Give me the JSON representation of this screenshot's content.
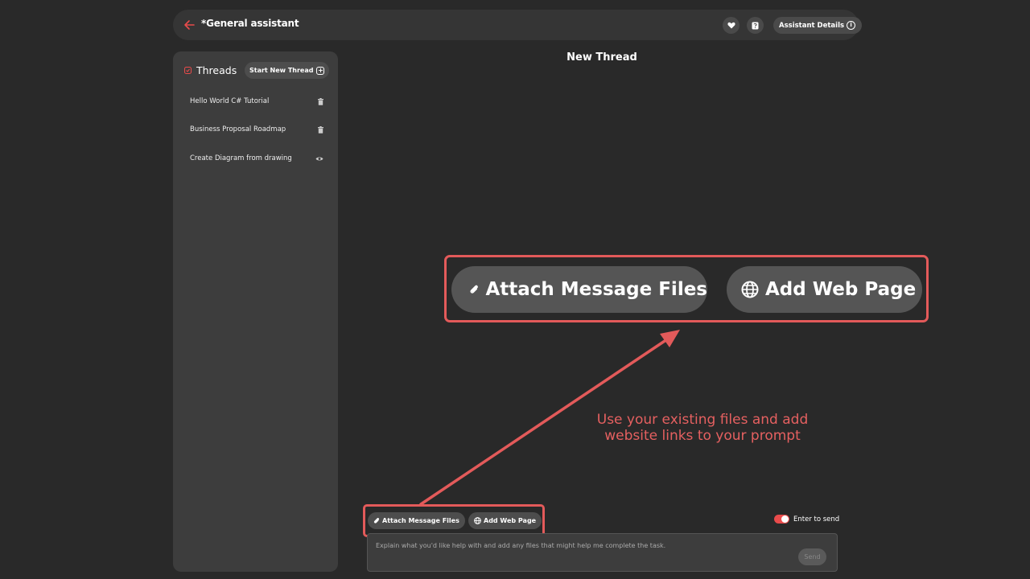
{
  "header": {
    "title": "*General assistant",
    "details_label": "Assistant Details",
    "info_symbol": "i",
    "icons": [
      "back-arrow-icon",
      "heart-icon",
      "question-icon",
      "info-icon"
    ]
  },
  "sidebar": {
    "title": "Threads",
    "new_thread_label": "Start New Thread",
    "plus_symbol": "+",
    "threads": [
      {
        "label": "Hello World C# Tutorial",
        "icon": "trash-icon"
      },
      {
        "label": "Business Proposal Roadmap",
        "icon": "trash-icon"
      },
      {
        "label": "Create Diagram from drawing",
        "icon": "eye-icon"
      }
    ]
  },
  "main": {
    "title": "New Thread"
  },
  "zoom_callout": {
    "attach_label": "Attach Message Files",
    "web_label": "Add Web Page"
  },
  "annotation": {
    "line1": "Use your existing files and add",
    "line2": "website links to your prompt"
  },
  "composer": {
    "attach_label": "Attach Message Files",
    "web_label": "Add Web Page",
    "enter_to_send_label": "Enter to send",
    "enter_to_send_on": true,
    "placeholder": "Explain what you'd like help with and add any files that might help me complete the task.",
    "send_label": "Send"
  },
  "colors": {
    "background": "#292929",
    "panel": "#3d3d3d",
    "accent": "#e94b4b",
    "annotation": "#e56060"
  }
}
